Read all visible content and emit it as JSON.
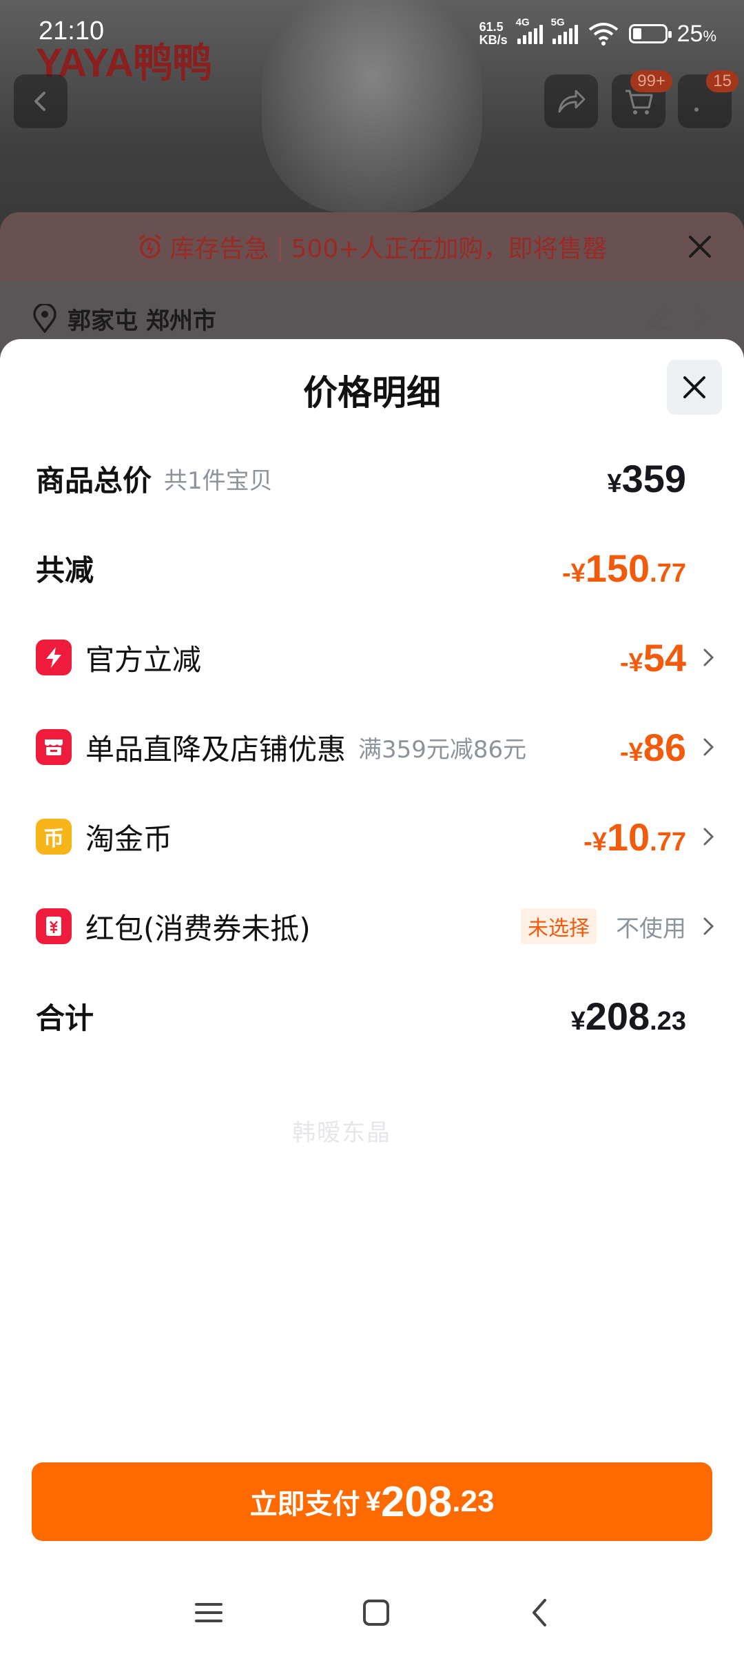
{
  "status_bar": {
    "time": "21:10",
    "net_speed_value": "61.5",
    "net_speed_unit": "KB/s",
    "signal1_label": "4G",
    "signal2_label": "5G",
    "battery": "25",
    "battery_unit": "%"
  },
  "background": {
    "brand": "YAYA鸭鸭",
    "cart_badge": "99+",
    "msg_badge": "15",
    "alert_title": "库存告急",
    "alert_separator": "|",
    "alert_message": "500+人正在加购，即将售罄",
    "address": "郭家屯 郑州市"
  },
  "sheet": {
    "title": "价格明细",
    "rows": {
      "total": {
        "label": "商品总价",
        "sub": "共1件宝贝",
        "currency": "¥",
        "int": "359",
        "dec": ""
      },
      "reduce": {
        "label": "共减",
        "prefix": "-¥",
        "int": "150",
        "dec": ".77"
      },
      "official": {
        "label": "官方立减",
        "prefix": "-¥",
        "int": "54",
        "dec": ""
      },
      "shop": {
        "label": "单品直降及店铺优惠",
        "sub": "满359元减86元",
        "prefix": "-¥",
        "int": "86",
        "dec": ""
      },
      "coins": {
        "label": "淘金币",
        "icon_text": "币",
        "prefix": "-¥",
        "int": "10",
        "dec": ".77"
      },
      "redpack": {
        "label": "红包(消费券未抵)",
        "tag": "未选择",
        "value": "不使用"
      },
      "sum": {
        "label": "合计",
        "currency": "¥",
        "int": "208",
        "dec": ".23"
      }
    },
    "watermark": "韩暧东晶"
  },
  "pay_button": {
    "label": "立即支付",
    "currency": "¥",
    "int": "208",
    "dec": ".23"
  },
  "colors": {
    "accent": "#ff6a00",
    "discount": "#f25a0c",
    "icon_red": "#ef1b3c",
    "icon_gold": "#f7b51a"
  }
}
